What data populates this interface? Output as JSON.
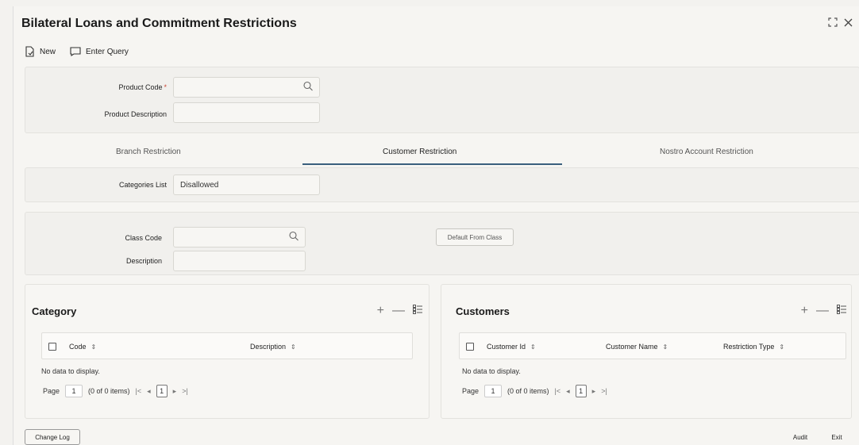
{
  "window": {
    "title": "Bilateral Loans and Commitment Restrictions"
  },
  "toolbar": {
    "new_label": "New",
    "enter_query_label": "Enter Query"
  },
  "product": {
    "code_label": "Product Code",
    "required_mark": "*",
    "code_value": "",
    "description_label": "Product Description",
    "description_value": ""
  },
  "tabs": [
    {
      "label": "Branch Restriction",
      "active": false
    },
    {
      "label": "Customer Restriction",
      "active": true
    },
    {
      "label": "Nostro Account Restriction",
      "active": false
    }
  ],
  "categories_list": {
    "label": "Categories List",
    "value": "Disallowed"
  },
  "class": {
    "code_label": "Class Code",
    "code_value": "",
    "description_label": "Description",
    "description_value": "",
    "default_button": "Default From Class"
  },
  "category_grid": {
    "title": "Category",
    "columns": [
      "Code",
      "Description"
    ],
    "no_data": "No data to display.",
    "pager": {
      "page_label": "Page",
      "page_value": "1",
      "items": "(0 of 0 items)",
      "current": "1"
    }
  },
  "customers_grid": {
    "title": "Customers",
    "columns": [
      "Customer Id",
      "Customer Name",
      "Restriction Type"
    ],
    "no_data": "No data to display.",
    "pager": {
      "page_label": "Page",
      "page_value": "1",
      "items": "(0 of 0 items)",
      "current": "1"
    }
  },
  "footer": {
    "change_log": "Change Log",
    "audit": "Audit",
    "exit": "Exit"
  },
  "icons": {
    "new": "new-document-icon",
    "enter_query": "query-icon",
    "search": "search-icon",
    "add": "plus-icon",
    "remove": "minus-icon",
    "columns": "column-list-icon",
    "sort": "sort-icon",
    "maximize": "maximize-icon",
    "close": "close-icon"
  },
  "colors": {
    "accent": "#3a5f7d",
    "required": "#c74634"
  }
}
